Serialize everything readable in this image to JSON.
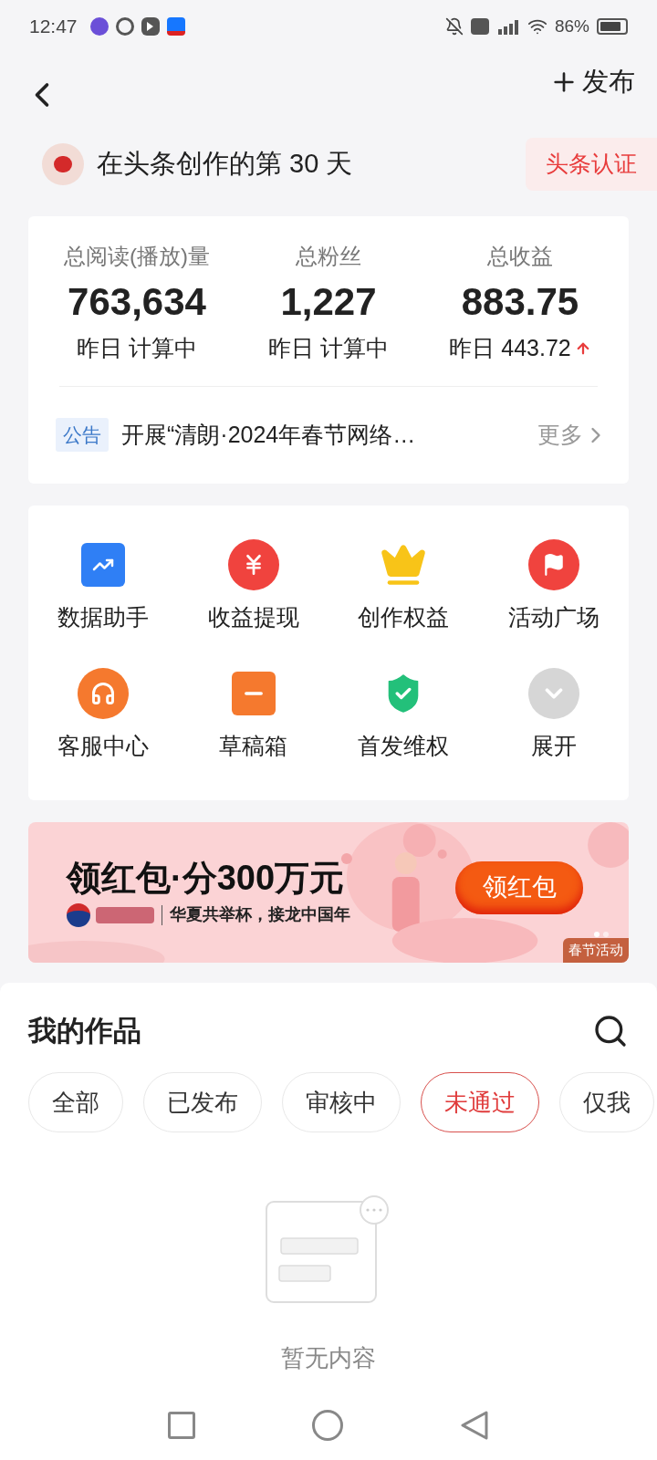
{
  "status_bar": {
    "time": "12:47",
    "battery": "86%"
  },
  "header": {
    "publish": "发布"
  },
  "creator": {
    "text": "在头条创作的第 30 天",
    "badge": "头条认证"
  },
  "stats": [
    {
      "label": "总阅读(播放)量",
      "value": "763,634",
      "sub": "昨日 计算中"
    },
    {
      "label": "总粉丝",
      "value": "1,227",
      "sub": "昨日 计算中"
    },
    {
      "label": "总收益",
      "value": "883.75",
      "sub": "昨日 443.72",
      "trend_up": true
    }
  ],
  "notice": {
    "tag": "公告",
    "text": "开展“清朗·2024年春节网络…",
    "more": "更多"
  },
  "tools": [
    {
      "label": "数据助手",
      "kind": "chart",
      "color": "#2f7ff5"
    },
    {
      "label": "收益提现",
      "kind": "yuan",
      "color": "#f0433e"
    },
    {
      "label": "创作权益",
      "kind": "crown",
      "color": "#f8c418"
    },
    {
      "label": "活动广场",
      "kind": "flag",
      "color": "#f0433e"
    },
    {
      "label": "客服中心",
      "kind": "headset",
      "color": "#f5792e"
    },
    {
      "label": "草稿箱",
      "kind": "draft",
      "color": "#f5792e"
    },
    {
      "label": "首发维权",
      "kind": "shield",
      "color": "#23c07a"
    },
    {
      "label": "展开",
      "kind": "expand",
      "color": "#d6d6d6"
    }
  ],
  "banner": {
    "headline": "领红包·分300万元",
    "slogan": "华夏共举杯，接龙中国年",
    "button": "领红包",
    "tag": "春节活动"
  },
  "works": {
    "title": "我的作品",
    "tabs": [
      {
        "label": "全部",
        "selected": false
      },
      {
        "label": "已发布",
        "selected": false
      },
      {
        "label": "审核中",
        "selected": false
      },
      {
        "label": "未通过",
        "selected": true
      },
      {
        "label": "仅我",
        "selected": false
      }
    ],
    "empty": "暂无内容"
  }
}
